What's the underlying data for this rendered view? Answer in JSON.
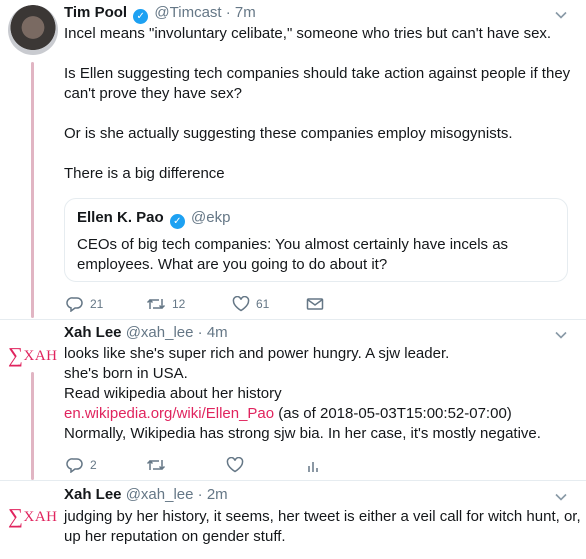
{
  "tweets": [
    {
      "name": "Tim Pool",
      "handle": "@Timcast",
      "dot": "·",
      "time": "7m",
      "lines": [
        "Incel means \"involuntary celibate,\" someone who tries but can't have sex.",
        "Is Ellen suggesting tech companies should take action against people if they",
        "can't prove they have sex?",
        "Or is she actually suggesting these companies employ misogynists.",
        "There is a big difference"
      ],
      "quote": {
        "name": "Ellen K. Pao",
        "handle": "@ekp",
        "lines": [
          "CEOs of big tech companies: You almost certainly have incels as",
          "employees. What are you going to do about it?"
        ]
      },
      "actions": {
        "replies": "21",
        "retweets": "12",
        "likes": "61"
      }
    },
    {
      "avatar_text": "XAH",
      "avatar_symbol": "∑",
      "name": "Xah Lee",
      "handle": "@xah_lee",
      "dot": "·",
      "time": "4m",
      "lines": [
        "looks like she's super rich and power hungry. A sjw leader.",
        "she's born in USA.",
        "Read wikipedia about her history"
      ],
      "link": "en.wikipedia.org/wiki/Ellen_Pao",
      "link_suffix": " (as of 2018-05-03T15:00:52-07:00)",
      "last_line": "Normally, Wikipedia has strong sjw bia. In her case, it's mostly negative.",
      "actions": {
        "replies": "2"
      }
    },
    {
      "avatar_text": "XAH",
      "avatar_symbol": "∑",
      "name": "Xah Lee",
      "handle": "@xah_lee",
      "dot": "·",
      "time": "2m",
      "lines": [
        "judging by her history, it seems, her tweet is either a veil call for witch hunt, or,",
        "up her reputation on gender stuff."
      ]
    }
  ],
  "colors": {
    "accent": "#e0245e",
    "verified": "#1da1f2",
    "muted": "#657786",
    "thread": "#e1b5c3"
  },
  "icons": [
    "reply-icon",
    "retweet-icon",
    "like-icon",
    "message-icon",
    "analytics-icon",
    "chevron-down-icon",
    "verified-icon"
  ]
}
